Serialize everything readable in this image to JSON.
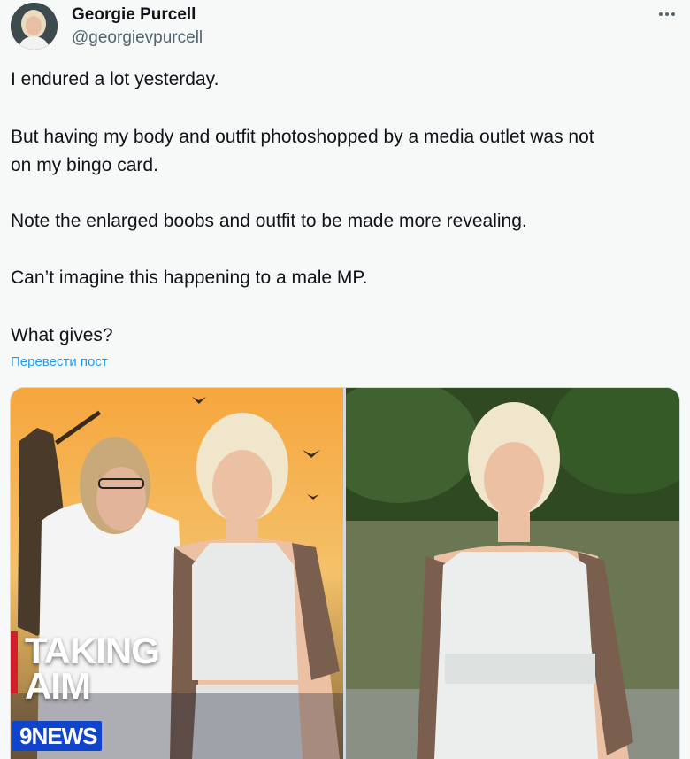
{
  "author": {
    "name": "Georgie Purcell",
    "handle": "@georgievpurcell"
  },
  "tweet": {
    "paragraphs": [
      "I endured a lot yesterday.",
      "But having my body and outfit photoshopped by a media outlet was not",
      "on my bingo card.",
      "Note the enlarged boobs and outfit to be made more revealing.",
      "Can’t imagine this happening to a male MP.",
      "What gives?"
    ],
    "translate_label": "Перевести пост"
  },
  "media": {
    "left_photo": {
      "overlay_title_line1": "TAKING",
      "overlay_title_line2": "AIM",
      "logo_text": "9NEWS"
    }
  },
  "colors": {
    "link": "#1d9bf0",
    "news_blue": "#1144cc",
    "news_red": "#d0202e"
  },
  "icons": [
    "more-options-icon"
  ]
}
